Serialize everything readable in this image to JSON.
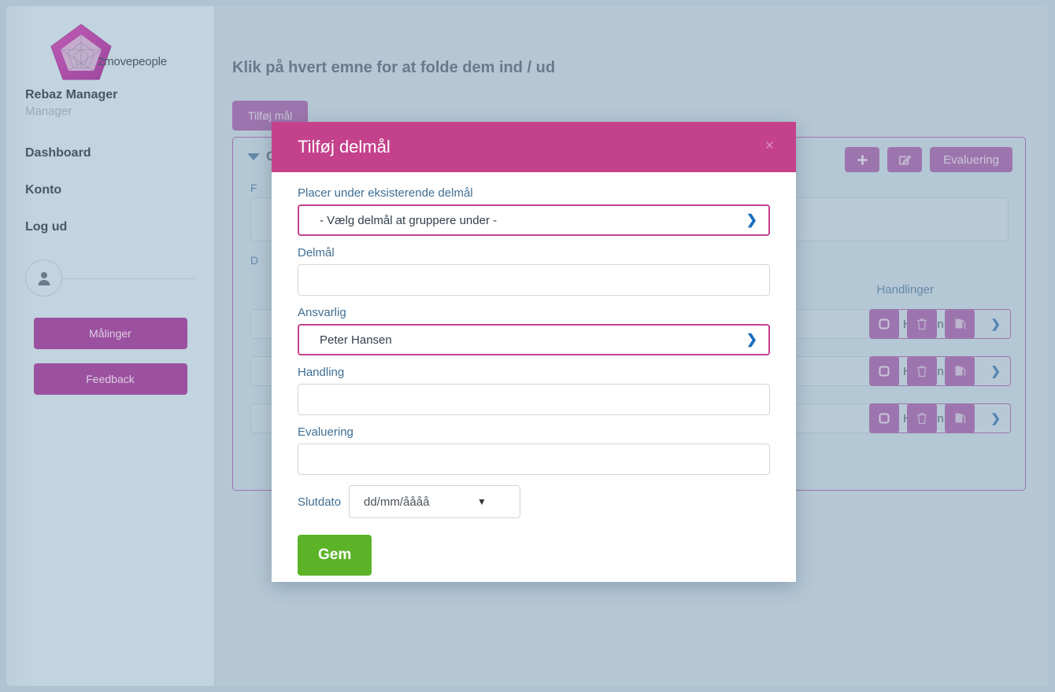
{
  "sidebar": {
    "logo_text": "2movepeople",
    "user_name": "Rebaz Manager",
    "user_role": "Manager",
    "nav": [
      {
        "label": "Dashboard"
      },
      {
        "label": "Konto"
      },
      {
        "label": "Log ud"
      }
    ],
    "buttons": [
      {
        "label": "Målinger"
      },
      {
        "label": "Feedback"
      }
    ]
  },
  "main": {
    "page_title": "Klik på hvert emne for at folde dem ind / ud",
    "add_goal_label": "Tilføj mål",
    "card": {
      "title": "O",
      "actions": {
        "add_label": "+",
        "edit_label": "",
        "evaluering_label": "Evaluering"
      },
      "labels": {
        "formaal": "F",
        "delmaal": "D",
        "handlinger": "Handlinger"
      },
      "rows": [
        {
          "responsible": "Hansen"
        },
        {
          "responsible": "Hansen"
        },
        {
          "responsible": "Hansen"
        }
      ]
    }
  },
  "modal": {
    "title": "Tilføj delmål",
    "close_label": "×",
    "fields": {
      "parent_label": "Placer under eksisterende delmål",
      "parent_value": "- Vælg delmål at gruppere under -",
      "delmaal_label": "Delmål",
      "delmaal_value": "",
      "delmaal_placeholder": "",
      "ansvarlig_label": "Ansvarlig",
      "ansvarlig_value": "Peter Hansen",
      "handling_label": "Handling",
      "handling_value": "",
      "handling_placeholder": "",
      "evaluering_label": "Evaluering",
      "evaluering_value": "",
      "evaluering_placeholder": "",
      "slutdato_label": "Slutdato",
      "slutdato_placeholder": "dd/mm/åååå"
    },
    "save_label": "Gem"
  },
  "colors": {
    "accent_magenta": "#c4428c",
    "accent_purple": "#9b50a0",
    "save_green": "#5cb327",
    "page_bg": "#c2d4df",
    "label_blue": "#3f6e93"
  }
}
